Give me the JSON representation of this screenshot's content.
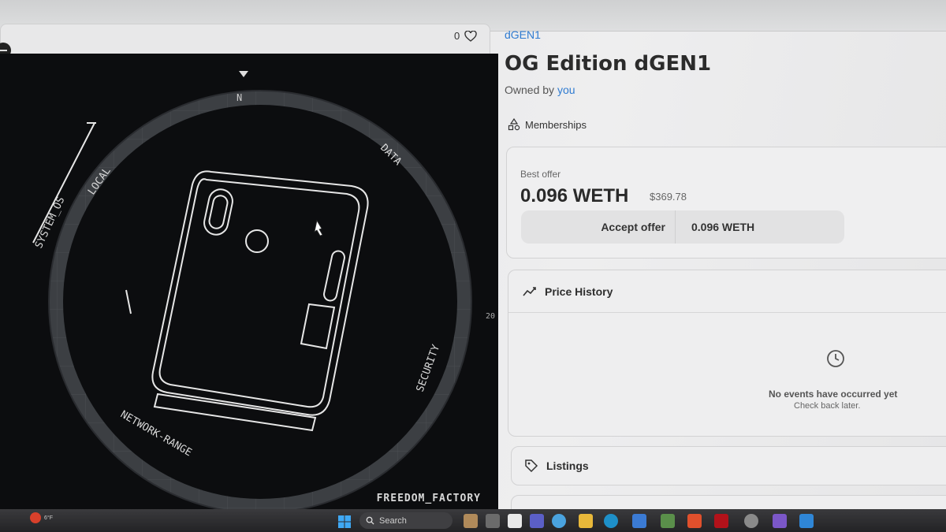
{
  "header": {
    "favorite_count": "0"
  },
  "artwork": {
    "ring_labels": [
      "SYSTEM_OS",
      "LOCAL",
      "DATA",
      "SECURITY",
      "NETWORK-RANGE"
    ],
    "compass_mark": "N",
    "side_number": "20",
    "brand_text": "FREEDOM_FACTORY"
  },
  "item": {
    "collection": "dGEN1",
    "title": "OG Edition dGEN1",
    "owned_by_label": "Owned by",
    "owner": "you",
    "memberships_label": "Memberships"
  },
  "offer": {
    "label": "Best offer",
    "price": "0.096 WETH",
    "usd": "$369.78",
    "accept_label": "Accept offer",
    "accept_amount": "0.096 WETH"
  },
  "price_history": {
    "title": "Price History",
    "empty_title": "No events have occurred yet",
    "empty_sub": "Check back later."
  },
  "listings": {
    "title": "Listings"
  },
  "taskbar": {
    "search_placeholder": "Search",
    "weather_temp": "6°F",
    "apps": [
      "file-manager-icon",
      "widgets-icon",
      "chat-icon",
      "teams-icon",
      "copilot-icon",
      "explorer-icon",
      "edge-icon",
      "store-icon",
      "stocks-icon",
      "brave-icon",
      "netflix-icon",
      "settings-icon",
      "phone-link-icon",
      "weather-app-icon"
    ]
  },
  "colors": {
    "link": "#2f7bd1",
    "artwork_bg": "#0c0d0f",
    "line_art": "#e6e6e6"
  }
}
